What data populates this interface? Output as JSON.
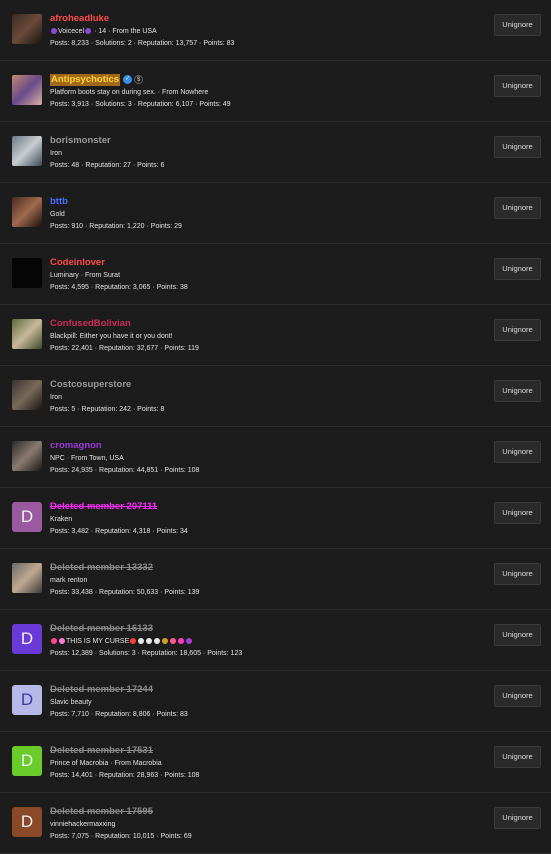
{
  "button_label": "Unignore",
  "members": [
    {
      "name": "afroheadluke",
      "name_color": "#ff4a4a",
      "deleted": false,
      "avatar": {
        "type": "photo",
        "colors": [
          "#3a2a24",
          "#6b4a3a",
          "#1a1410"
        ]
      },
      "title": "Voicecel",
      "title_suffix": "· 14 · From the USA",
      "emoji_left": "purple-orb-icon",
      "emoji_right": "purple-orb-icon",
      "stats": "Posts: 8,233 · Solutions: 2 · Reputation: 13,757 · Points: 83"
    },
    {
      "name": "Antipsychotics",
      "name_color": "#ffd23a",
      "name_bg": "#a06a1a",
      "deleted": false,
      "verified": true,
      "has_dollar": true,
      "avatar": {
        "type": "photo",
        "colors": [
          "#c08a70",
          "#6a4a8a",
          "#d8b0a0"
        ]
      },
      "title": "Platform boots stay on during sex. · From Nowhere",
      "stats": "Posts: 3,913 · Solutions: 3 · Reputation: 6,107 · Points: 49"
    },
    {
      "name": "borismonster",
      "name_color": "#9a9a9a",
      "deleted": false,
      "avatar": {
        "type": "photo",
        "colors": [
          "#6a7a88",
          "#c8ccd0",
          "#3a4a58"
        ]
      },
      "title": "Iron",
      "stats": "Posts: 48 · Reputation: 27 · Points: 6"
    },
    {
      "name": "bttb",
      "name_color": "#4a6cff",
      "deleted": false,
      "avatar": {
        "type": "photo",
        "colors": [
          "#4a2a20",
          "#a06a50",
          "#1c100c"
        ]
      },
      "title": "Gold",
      "stats": "Posts: 910 · Reputation: 1,220 · Points: 29"
    },
    {
      "name": "Codeinlover",
      "name_color": "#ff4a4a",
      "deleted": false,
      "avatar": {
        "type": "photo",
        "colors": [
          "#050505",
          "#050505",
          "#050505"
        ]
      },
      "title": "Luminary · From Surat",
      "stats": "Posts: 4,595 · Reputation: 3,065 · Points: 38"
    },
    {
      "name": "ConfusedBolivian",
      "name_color": "#cc2a5a",
      "deleted": false,
      "avatar": {
        "type": "photo",
        "colors": [
          "#5a6a3a",
          "#c8b89a",
          "#3a4a28"
        ]
      },
      "title": "Blackpill: Either you have it or you dont!",
      "stats": "Posts: 22,401 · Reputation: 32,677 · Points: 119"
    },
    {
      "name": "Costcosuperstore",
      "name_color": "#9a9a9a",
      "deleted": false,
      "avatar": {
        "type": "photo",
        "colors": [
          "#3a3430",
          "#7a6a5a",
          "#1a1614"
        ]
      },
      "title": "Iron",
      "stats": "Posts: 5 · Reputation: 242 · Points: 8"
    },
    {
      "name": "cromagnon",
      "name_color": "#9a3ad8",
      "deleted": false,
      "avatar": {
        "type": "photo",
        "colors": [
          "#2a2a2a",
          "#8a7a70",
          "#1a1a1a"
        ]
      },
      "title": "NPC · From Town, USA",
      "stats": "Posts: 24,935 · Reputation: 44,851 · Points: 108"
    },
    {
      "name": "Deleted member 207111",
      "name_color": "#ff2aff",
      "deleted": true,
      "avatar": {
        "type": "letter",
        "letter": "D",
        "bg": "#9a5aa0"
      },
      "title": "Kraken",
      "stats": "Posts: 3,482 · Reputation: 4,318 · Points: 34"
    },
    {
      "name": "Deleted member 13332",
      "name_color": "#8a8a8a",
      "deleted": true,
      "avatar": {
        "type": "photo",
        "colors": [
          "#6a6a6a",
          "#c0a890",
          "#3a3a3a"
        ]
      },
      "title": "mark renton",
      "stats": "Posts: 33,438 · Reputation: 50,633 · Points: 139"
    },
    {
      "name": "Deleted member 16133",
      "name_color": "#8a8a8a",
      "deleted": true,
      "avatar": {
        "type": "letter",
        "letter": "D",
        "bg": "#6a3ad8"
      },
      "title": "THIS IS MY CURSE",
      "emoji_title": true,
      "stats": "Posts: 12,389 · Solutions: 3 · Reputation: 18,605 · Points: 123"
    },
    {
      "name": "Deleted member 17244",
      "name_color": "#8a8a8a",
      "deleted": true,
      "avatar": {
        "type": "letter",
        "letter": "D",
        "bg": "#b8b8e8",
        "fg": "#3a3ab0"
      },
      "title": "Slavic beauty",
      "stats": "Posts: 7,710 · Reputation: 8,806 · Points: 83"
    },
    {
      "name": "Deleted member 17531",
      "name_color": "#8a8a8a",
      "deleted": true,
      "avatar": {
        "type": "letter",
        "letter": "D",
        "bg": "#6acc2a"
      },
      "title": "Prince of Macrobia · From Macrobia",
      "stats": "Posts: 14,401 · Reputation: 28,963 · Points: 108"
    },
    {
      "name": "Deleted member 17595",
      "name_color": "#8a8a8a",
      "deleted": true,
      "avatar": {
        "type": "letter",
        "letter": "D",
        "bg": "#8a4a2a"
      },
      "title": "vinniehackermaxxing",
      "stats": "Posts: 7,075 · Reputation: 10,015 · Points: 69"
    }
  ]
}
